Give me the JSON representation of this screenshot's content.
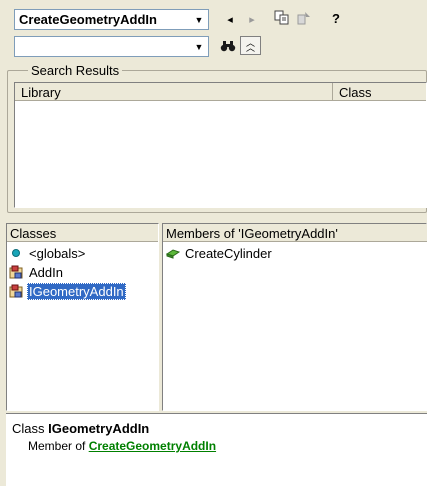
{
  "toolbar": {
    "library_combo_value": "CreateGeometryAddIn",
    "search_combo_value": "",
    "icons": [
      "back-icon",
      "forward-icon",
      "copy-icon",
      "view-definition-icon",
      "help-icon",
      "search-icon",
      "toggle-search-results-icon"
    ]
  },
  "search_results": {
    "group_label": "Search Results",
    "columns": [
      "Library",
      "Class"
    ]
  },
  "classes": {
    "header": "Classes",
    "items": [
      {
        "label": "<globals>",
        "icon": "globals-icon"
      },
      {
        "label": "AddIn",
        "icon": "class-icon"
      },
      {
        "label": "IGeometryAddIn",
        "icon": "class-icon",
        "selected": true
      }
    ]
  },
  "members": {
    "header": "Members of 'IGeometryAddIn'",
    "items": [
      {
        "label": "CreateCylinder",
        "icon": "method-icon"
      }
    ]
  },
  "details": {
    "prefix": "Class ",
    "class_name": "IGeometryAddIn",
    "member_of": "Member of ",
    "library_link": "CreateGeometryAddIn"
  },
  "colors": {
    "selection": "#316ac5",
    "link": "#008000",
    "face": "#ece9d8"
  }
}
